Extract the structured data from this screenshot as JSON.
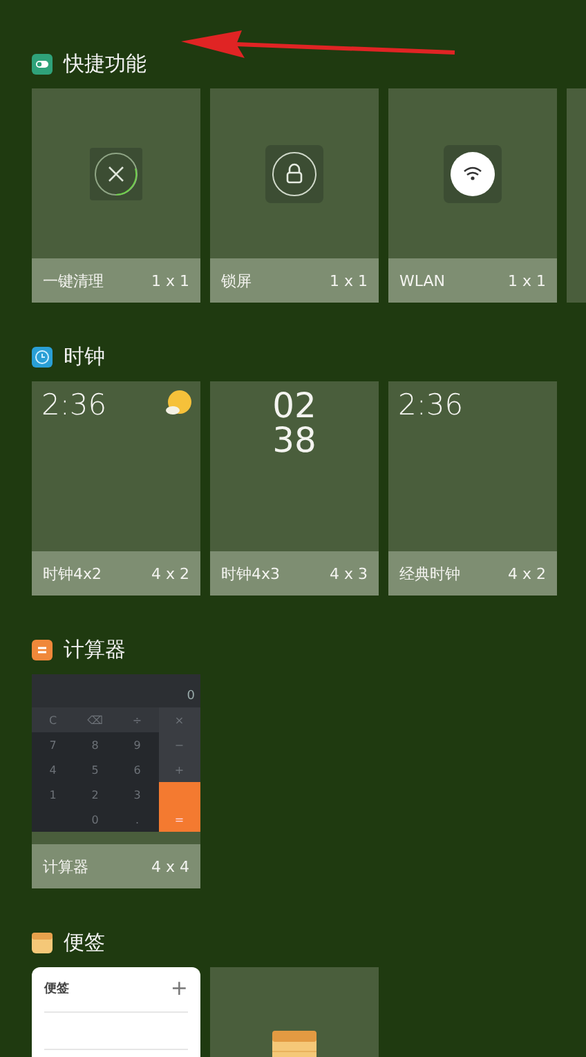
{
  "sections": [
    {
      "title": "快捷功能",
      "widgets": [
        {
          "kind": "shortcut",
          "name": "一键清理",
          "size": "1 x 1"
        },
        {
          "kind": "shortcut",
          "name": "锁屏",
          "size": "1 x 1"
        },
        {
          "kind": "shortcut",
          "name": "WLAN",
          "size": "1 x 1"
        },
        {
          "kind": "partial"
        }
      ]
    },
    {
      "title": "时钟",
      "widgets": [
        {
          "kind": "clock_wide",
          "time": "2:36",
          "name": "时钟4x2",
          "size": "4 x 2"
        },
        {
          "kind": "clock_stack",
          "hours": "02",
          "minutes": "38",
          "name": "时钟4x3",
          "size": "4 x 3"
        },
        {
          "kind": "clock_classic",
          "time": "2:36",
          "name": "经典时钟",
          "size": "4 x 2"
        }
      ]
    },
    {
      "title": "计算器",
      "widgets": [
        {
          "kind": "calculator",
          "display": "0",
          "name": "计算器",
          "size": "4 x 4",
          "pad": [
            {
              "kind": "func",
              "label": "C"
            },
            {
              "kind": "func",
              "label": "⌫"
            },
            {
              "kind": "func",
              "label": "÷"
            },
            {
              "kind": "num",
              "label": "7"
            },
            {
              "kind": "num",
              "label": "8"
            },
            {
              "kind": "num",
              "label": "9"
            },
            {
              "kind": "num",
              "label": "4"
            },
            {
              "kind": "num",
              "label": "5"
            },
            {
              "kind": "num",
              "label": "6"
            },
            {
              "kind": "num",
              "label": "1"
            },
            {
              "kind": "num",
              "label": "2"
            },
            {
              "kind": "num",
              "label": "3"
            },
            {
              "kind": "blank"
            },
            {
              "kind": "num",
              "label": "0"
            },
            {
              "kind": "num",
              "label": "."
            }
          ],
          "ops": [
            {
              "kind": "op",
              "label": "×"
            },
            {
              "kind": "op",
              "label": "−"
            },
            {
              "kind": "op",
              "label": "+"
            },
            {
              "kind": "equals",
              "label": "="
            }
          ]
        }
      ]
    },
    {
      "title": "便签",
      "widgets": [
        {
          "kind": "notes_list",
          "title": "便签",
          "action": "+"
        },
        {
          "kind": "notes_icon"
        }
      ]
    }
  ]
}
